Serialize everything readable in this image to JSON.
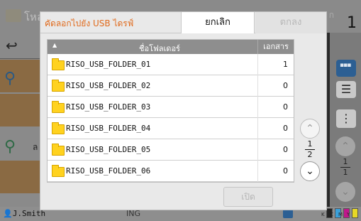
{
  "background": {
    "header_title": "โหล",
    "header_right_label": "ก",
    "header_count": "1",
    "side_label": "ล",
    "bottom_user": "J.Smith",
    "bottom_middle": "ING",
    "page_current": "1",
    "page_total": "1",
    "inks": [
      "K",
      "C",
      "M",
      "Y"
    ]
  },
  "dialog": {
    "title": "คัดลอกไปยัง USB ไดรฟ์",
    "cancel_label": "ยกเลิก",
    "ok_label": "ตกลง",
    "open_label": "เปิด",
    "table": {
      "col_folder": "ชื่อโฟลเดอร์",
      "col_docs": "เอกสาร",
      "sort_icon": "sort-ascending-icon",
      "rows": [
        {
          "name": "RISO_USB_FOLDER_01",
          "count": "1"
        },
        {
          "name": "RISO_USB_FOLDER_02",
          "count": "0"
        },
        {
          "name": "RISO_USB_FOLDER_03",
          "count": "0"
        },
        {
          "name": "RISO_USB_FOLDER_04",
          "count": "0"
        },
        {
          "name": "RISO_USB_FOLDER_05",
          "count": "0"
        },
        {
          "name": "RISO_USB_FOLDER_06",
          "count": "0"
        }
      ]
    },
    "pager": {
      "current": "1",
      "total": "2"
    }
  },
  "colors": {
    "title_accent": "#e06a1c",
    "folder_icon": "#ffd21f",
    "table_header": "#8e8e8e"
  }
}
